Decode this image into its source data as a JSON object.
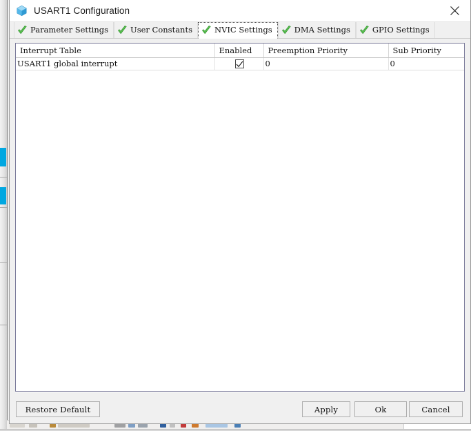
{
  "dialog": {
    "title": "USART1 Configuration",
    "title_icon": "cube-icon",
    "close_icon": "close-icon"
  },
  "tabs": [
    {
      "label": "Parameter Settings",
      "icon": "green-check-icon",
      "selected": false
    },
    {
      "label": "User Constants",
      "icon": "green-check-icon",
      "selected": false
    },
    {
      "label": "NVIC Settings",
      "icon": "green-check-icon",
      "selected": true
    },
    {
      "label": "DMA Settings",
      "icon": "green-check-icon",
      "selected": false
    },
    {
      "label": "GPIO Settings",
      "icon": "green-check-icon",
      "selected": false
    }
  ],
  "table": {
    "columns": [
      "Interrupt Table",
      "Enabled",
      "Preemption Priority",
      "Sub Priority"
    ],
    "rows": [
      {
        "name": "USART1 global interrupt",
        "enabled": true,
        "preemption_priority": "0",
        "sub_priority": "0"
      }
    ]
  },
  "footer": {
    "restore_label": "Restore Default",
    "apply_label": "Apply",
    "ok_label": "Ok",
    "cancel_label": "Cancel"
  },
  "colors": {
    "accent_blue": "#00a7e1",
    "check_green": "#4cb648",
    "dialog_bg": "#f0f0f0",
    "table_bg": "#ffffff",
    "priority_text": "#9aa3b5"
  }
}
